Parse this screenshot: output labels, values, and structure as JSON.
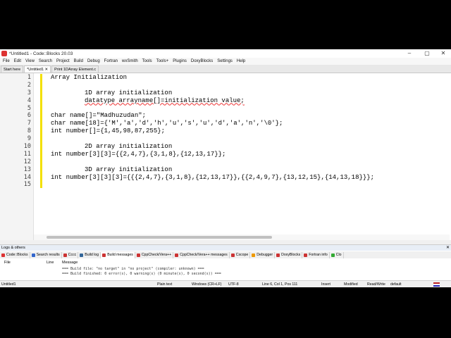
{
  "window": {
    "title": "*Untitled1 - Code::Blocks 20.03",
    "controls": [
      "–",
      "▢",
      "✕"
    ]
  },
  "menu": [
    "File",
    "Edit",
    "View",
    "Search",
    "Project",
    "Build",
    "Debug",
    "Fortran",
    "wxSmith",
    "Tools",
    "Tools+",
    "Plugins",
    "DoxyBlocks",
    "Settings",
    "Help"
  ],
  "tabs": [
    {
      "label": "Start here"
    },
    {
      "label": "*Untitled1 ✕"
    },
    {
      "label": "Print 1DArray Element.c"
    }
  ],
  "editor": {
    "line_numbers": [
      "1",
      "2",
      "3",
      "4",
      "5",
      "6",
      "7",
      "8",
      "9",
      "10",
      "11",
      "12",
      "13",
      "14",
      "15"
    ],
    "lines": [
      {
        "text": "Array Initialization",
        "indent": false
      },
      {
        "text": "",
        "indent": false
      },
      {
        "text": "1D array initialization",
        "indent": true
      },
      {
        "text": "datatype arrayname[]=initialization value;",
        "indent": true
      },
      {
        "text": "",
        "indent": false
      },
      {
        "text": "char name[]=\"Madhuzudan\";",
        "indent": false
      },
      {
        "text": "char name[18]={'M','a','d','h','u','s','u','d','a','n','\\0'};",
        "indent": false
      },
      {
        "text": "int number[]={1,45,98,87,255};",
        "indent": false
      },
      {
        "text": "",
        "indent": false
      },
      {
        "text": "2D array initialization",
        "indent": true
      },
      {
        "text": "int number[3][3]={{2,4,7},{3,1,8},{12,13,17}};",
        "indent": false
      },
      {
        "text": "",
        "indent": false
      },
      {
        "text": "3D array initialization",
        "indent": true
      },
      {
        "text": "int number[3][3][3]={{{2,4,7},{3,1,8},{12,13,17}},{{2,4,9,7},{13,12,15},{14,13,18}}};",
        "indent": false
      },
      {
        "text": "",
        "indent": false
      }
    ]
  },
  "logs": {
    "title": "Logs & others",
    "tabs": [
      "Code::Blocks",
      "Search results",
      "Cccc",
      "Build log",
      "Build messages",
      "CppCheck/Vera++",
      "CppCheck/Vera++ messages",
      "Cscope",
      "Debugger",
      "DoxyBlocks",
      "Fortran info",
      "Clo"
    ],
    "columns": {
      "file": "File",
      "line": "Line",
      "message": "Message"
    },
    "messages": [
      "=== Build file: \"no target\" in \"no project\" (compiler: unknown) ===",
      "=== Build finished: 0 error(s), 0 warning(s) (0 minute(s), 0 second(s)) ==="
    ]
  },
  "status": {
    "file": "Untitled1",
    "language": "Plain text",
    "eol": "Windows (CR+LF)",
    "encoding": "UTF-8",
    "position": "Line 6, Col 1, Pos 111",
    "mode": "Insert",
    "modified": "Modified",
    "access": "Read/Write",
    "profile": "default"
  }
}
